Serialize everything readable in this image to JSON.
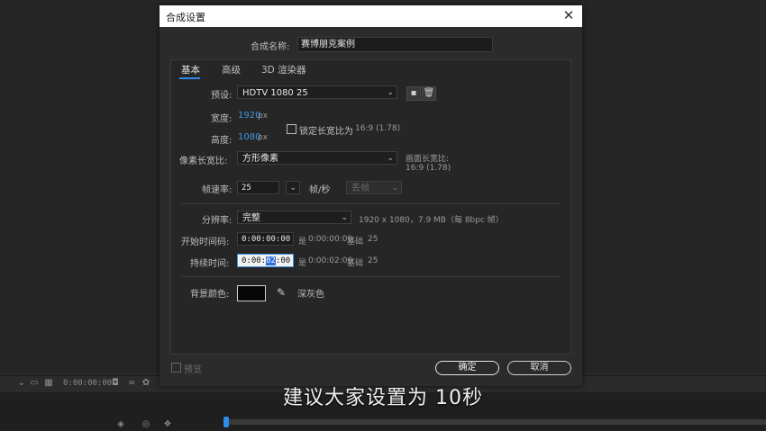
{
  "background": {
    "timeline_time": "0:00:00:00"
  },
  "dialog": {
    "title": "合成设置",
    "name_label": "合成名称:",
    "name_value": "赛博朋克案例",
    "tabs": [
      "基本",
      "高级",
      "3D 渲染器"
    ],
    "preset_label": "预设:",
    "preset_value": "HDTV 1080 25",
    "width_label": "宽度:",
    "width_value": "1920",
    "width_unit": "px",
    "height_label": "高度:",
    "height_value": "1080",
    "height_unit": "px",
    "lock_label": "锁定长宽比为",
    "lock_ratio": "16:9 (1.78)",
    "pixel_aspect_label": "像素长宽比:",
    "pixel_aspect_value": "方形像素",
    "frame_aspect_label": "画面长宽比:",
    "frame_aspect_value": "16:9 (1.78)",
    "fps_label": "帧速率:",
    "fps_value": "25",
    "fps_unit": "帧/秒",
    "drop_frame": "丢帧",
    "resolution_label": "分辨率:",
    "resolution_value": "完整",
    "resolution_info": "1920 x 1080，7.9 MB（每 8bpc 帧）",
    "start_tc_label": "开始时间码:",
    "start_tc_value": "0:00:00:00",
    "start_tc_info_prefix": "是",
    "start_tc_info": "0:00:00:00",
    "start_base": "基础",
    "start_base_value": "25",
    "duration_label": "持续时间:",
    "duration_pre": "0:00:",
    "duration_sel": "02",
    "duration_post": ":00",
    "duration_info_prefix": "是",
    "duration_info": "0:00:02:00",
    "duration_base": "基础",
    "duration_base_value": "25",
    "bg_color_label": "背景颜色:",
    "bg_color_name": "深灰色",
    "preview_label": "预览",
    "ok_label": "确定",
    "cancel_label": "取消"
  },
  "subtitle": "建议大家设置为  10秒",
  "colors": {
    "accent": "#2d8ceb",
    "value_blue": "#3e96e6",
    "swatch": "#080808"
  }
}
